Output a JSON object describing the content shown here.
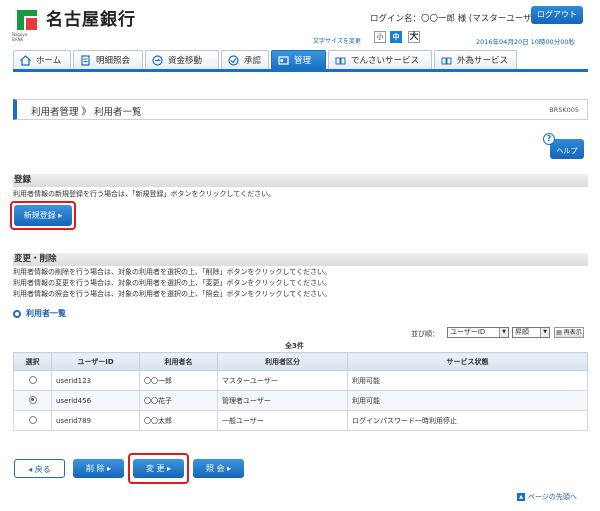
{
  "header": {
    "bank_name": "名古屋銀行",
    "bank_sub_line1": "Nagoya",
    "bank_sub_line2": "BANK",
    "login_name": "ログイン名：〇〇一郎 様 (マスターユーザー)",
    "logout_label": "ログアウト",
    "fontsize_label": "文字サイズを変更",
    "fontsize_small": "小",
    "fontsize_mid": "中",
    "fontsize_large": "大",
    "datetime": "2016年04月20日 10時00分00秒"
  },
  "nav": {
    "tabs": [
      {
        "label": "ホーム"
      },
      {
        "label": "明細照会"
      },
      {
        "label": "資金移動"
      },
      {
        "label": "承認"
      },
      {
        "label": "管理"
      },
      {
        "label": "でんさいサービス"
      },
      {
        "label": "外為サービス"
      }
    ]
  },
  "page": {
    "title": "利用者管理 》 利用者一覧",
    "code": "BRSK005",
    "help_label": "ヘルプ",
    "help_q": "?"
  },
  "register": {
    "heading": "登録",
    "description": "利用者情報の新規登録を行う場合は、「新規登録」ボタンをクリックしてください。",
    "button_label": "新規登録"
  },
  "modify": {
    "heading": "変更・削除",
    "desc1": "利用者情報の削除を行う場合は、対象の利用者を選択の上、「削除」ボタンをクリックしてください。",
    "desc2": "利用者情報の変更を行う場合は、対象の利用者を選択の上、「変更」ボタンをクリックしてください。",
    "desc3": "利用者情報の照会を行う場合は、対象の利用者を選択の上、「照会」ボタンをクリックしてください。"
  },
  "list": {
    "link_label": "利用者一覧",
    "sort_label": "並び順：",
    "sort_key": "ユーザーID",
    "sort_order": "昇順",
    "redisplay_label": "再表示",
    "total": "全3件",
    "columns": [
      "選択",
      "ユーザーID",
      "利用者名",
      "利用者区分",
      "サービス状態"
    ],
    "rows": [
      {
        "selected": false,
        "user_id": "userid123",
        "name": "〇〇一郎",
        "type": "マスターユーザー",
        "status": "利用可能"
      },
      {
        "selected": true,
        "user_id": "userid456",
        "name": "〇〇花子",
        "type": "管理者ユーザー",
        "status": "利用可能"
      },
      {
        "selected": false,
        "user_id": "userid789",
        "name": "〇〇太郎",
        "type": "一般ユーザー",
        "status": "ログインパスワード一時利用停止"
      }
    ]
  },
  "actions": {
    "back_label": "戻る",
    "delete_label": "削 除",
    "change_label": "変 更",
    "inquiry_label": "照 会"
  },
  "footer": {
    "page_top_label": "ページの先頭へ"
  },
  "colors": {
    "accent": "#1b6fc0",
    "highlight_frame": "#e41a1a",
    "logo_green": "#1a9a3e"
  }
}
